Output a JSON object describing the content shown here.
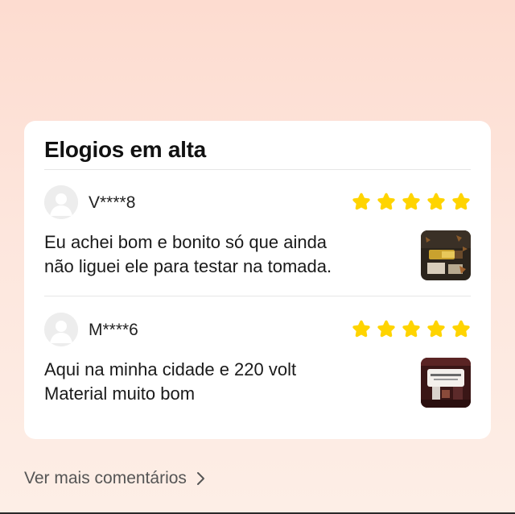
{
  "section": {
    "title": "Elogios em alta"
  },
  "colors": {
    "star": "#ffd400",
    "background_top": "#fddcd0",
    "card": "#ffffff"
  },
  "reviews": [
    {
      "username": "V****8",
      "rating": 5,
      "text": "Eu achei bom e bonito só que ainda\nnão liguei ele para testar na tomada.",
      "avatar_icon": "default-user-icon",
      "thumbnail": "product-photo"
    },
    {
      "username": "M****6",
      "rating": 5,
      "text": "Aqui na minha cidade e  220 volt\nMaterial muito bom",
      "avatar_icon": "default-user-icon",
      "thumbnail": "product-photo"
    }
  ],
  "footer": {
    "more_label": "Ver mais comentários",
    "more_icon": "chevron-right-icon"
  }
}
